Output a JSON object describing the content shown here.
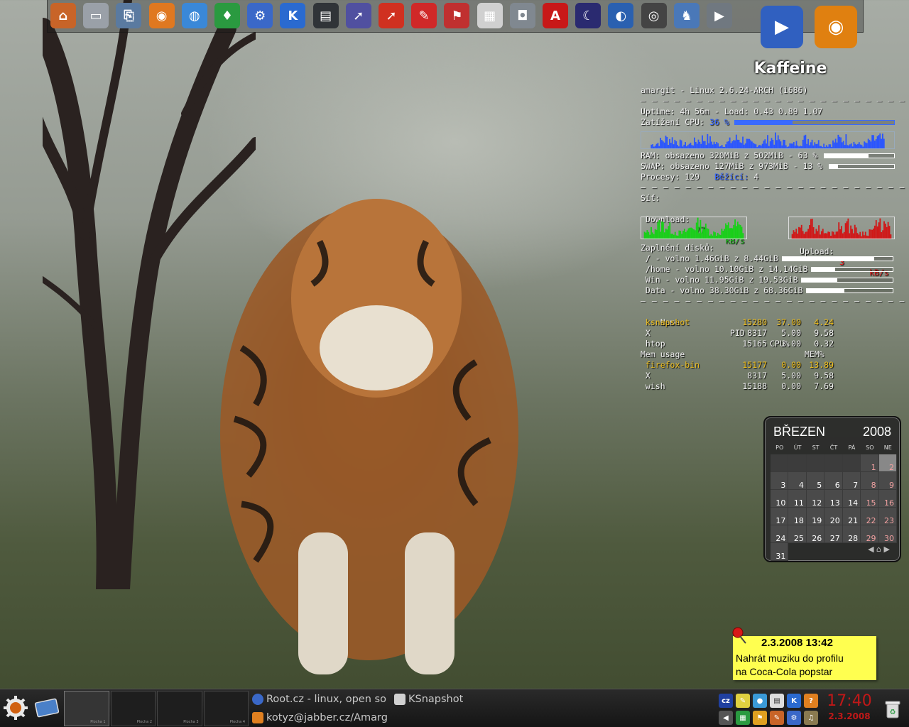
{
  "dock": {
    "launchers": [
      {
        "name": "home-icon",
        "glyph": "⌂",
        "color": "#c86428"
      },
      {
        "name": "drive-icon",
        "glyph": "▭",
        "color": "#9aa0a8"
      },
      {
        "name": "removable-drive-icon",
        "glyph": "⎘",
        "color": "#5a7aa0"
      },
      {
        "name": "firefox-icon",
        "glyph": "◉",
        "color": "#e07820"
      },
      {
        "name": "globe-icon",
        "glyph": "◍",
        "color": "#3a88d8"
      },
      {
        "name": "location-pin-icon",
        "glyph": "♦",
        "color": "#2a9a40"
      },
      {
        "name": "network-icon",
        "glyph": "⚙",
        "color": "#3a68c8"
      },
      {
        "name": "kde-icon",
        "glyph": "K",
        "color": "#2a6ad0"
      },
      {
        "name": "terminal-icon",
        "glyph": "▤",
        "color": "#303438"
      },
      {
        "name": "screenshot-icon",
        "glyph": "➚",
        "color": "#5050a0"
      },
      {
        "name": "presentation-icon",
        "glyph": "➚",
        "color": "#d03020"
      },
      {
        "name": "pencil-icon",
        "glyph": "✎",
        "color": "#d02828"
      },
      {
        "name": "flag-icon",
        "glyph": "⚑",
        "color": "#c03030"
      },
      {
        "name": "calendar-icon",
        "glyph": "▦",
        "color": "#d0d0d0"
      },
      {
        "name": "camera-icon",
        "glyph": "◘",
        "color": "#808890"
      },
      {
        "name": "pdf-icon",
        "glyph": "A",
        "color": "#c81818"
      },
      {
        "name": "night-sky-icon",
        "glyph": "☾",
        "color": "#2a2a70"
      },
      {
        "name": "earth-icon",
        "glyph": "◐",
        "color": "#2a60b0"
      },
      {
        "name": "speaker-icon",
        "glyph": "◎",
        "color": "#444444"
      },
      {
        "name": "wolf-icon",
        "glyph": "♞",
        "color": "#4a78b8"
      },
      {
        "name": "video-projector-icon",
        "glyph": "▶",
        "color": "#707880"
      }
    ],
    "big": [
      {
        "name": "kaffeine-icon",
        "glyph": "▶",
        "color": "#3060c0"
      },
      {
        "name": "burner-icon",
        "glyph": "◉",
        "color": "#e08010"
      }
    ]
  },
  "kaffeine_label": "Kaffeine",
  "conky": {
    "host": "amargit - Linux 2.6.24-ARCH (i686)",
    "separator": "— — — — — — — — — — — — — — — — — — — — — — — — —",
    "uptime": "Uptime: 4h 56m - Load: 0.43 0.89 1.07",
    "cpu_label": "Zatížení CPU: ",
    "cpu_value": "36 %",
    "cpu_fraction": 0.36,
    "ram": "RAM: obsazeno 320MiB z 502MiB - 63 %",
    "ram_fraction": 0.63,
    "swap": "SWAP: obsazeno 127MiB z 973MiB - 13 %",
    "swap_fraction": 0.13,
    "procs_label": "Procesy: 129",
    "running_label": "Běžící:",
    "running_value": "4",
    "net_label": "Síť:",
    "download_label": "Download:",
    "download_value": "77",
    "download_unit": "kB/s",
    "upload_label": "Upload:",
    "upload_value": "3",
    "upload_unit": "kB/s",
    "disks_label": "Zaplnění disků:",
    "disks": [
      {
        "text": " / - volno 1.46GiB z 8.44GiB",
        "used": 0.83
      },
      {
        "text": " /home - volno 10.10GiB z 14.14GiB",
        "used": 0.29
      },
      {
        "text": " Win - volno 11.95GiB z 19.53GiB",
        "used": 0.39
      },
      {
        "text": " Data - volno 38.30GiB z 68.36GiB",
        "used": 0.44
      }
    ],
    "top_header": {
      "name": "Name",
      "pid": "PID",
      "cpu": "CPU%",
      "mem": "MEM%"
    },
    "top_cpu": [
      {
        "name": " ksnapshot",
        "pid": "15280",
        "cpu": "37.00",
        "mem": "4.24",
        "highlight": true
      },
      {
        "name": " X",
        "pid": "8317",
        "cpu": "5.00",
        "mem": "9.58",
        "highlight": false
      },
      {
        "name": " htop",
        "pid": "15165",
        "cpu": "3.00",
        "mem": "0.32",
        "highlight": false
      }
    ],
    "mem_usage_label": "Mem usage",
    "top_mem": [
      {
        "name": " firefox-bin",
        "pid": "15177",
        "cpu": "0.00",
        "mem": "13.89",
        "highlight": true
      },
      {
        "name": " X",
        "pid": "8317",
        "cpu": "5.00",
        "mem": "9.58",
        "highlight": false
      },
      {
        "name": " wish",
        "pid": "15188",
        "cpu": "0.00",
        "mem": "7.69",
        "highlight": false
      }
    ]
  },
  "calendar": {
    "month": "BŘEZEN",
    "year": "2008",
    "weekdays": [
      "PO",
      "ÚT",
      "ST",
      "ČT",
      "PÁ",
      "SO",
      "NE"
    ],
    "leading_blanks": 5,
    "days": 31,
    "today": 2
  },
  "note": {
    "title": "2.3.2008 13:42",
    "line1": "Nahrát muziku do profilu",
    "line2": "na Coca-Cola popstar"
  },
  "taskbar": {
    "tasks": [
      {
        "label": "Root.cz - linux, open so",
        "icon_color": "#3a68c8"
      },
      {
        "label": "KSnapshot",
        "icon_color": "#d0d0d0"
      },
      {
        "label": "kotyz@jabber.cz/Amarg",
        "icon_color": "#e08020"
      }
    ],
    "pager": [
      "Plocha 1",
      "Plocha 2",
      "Plocha 3",
      "Plocha 4"
    ],
    "clock_time": "17:40",
    "clock_date": "2.3.2008"
  }
}
